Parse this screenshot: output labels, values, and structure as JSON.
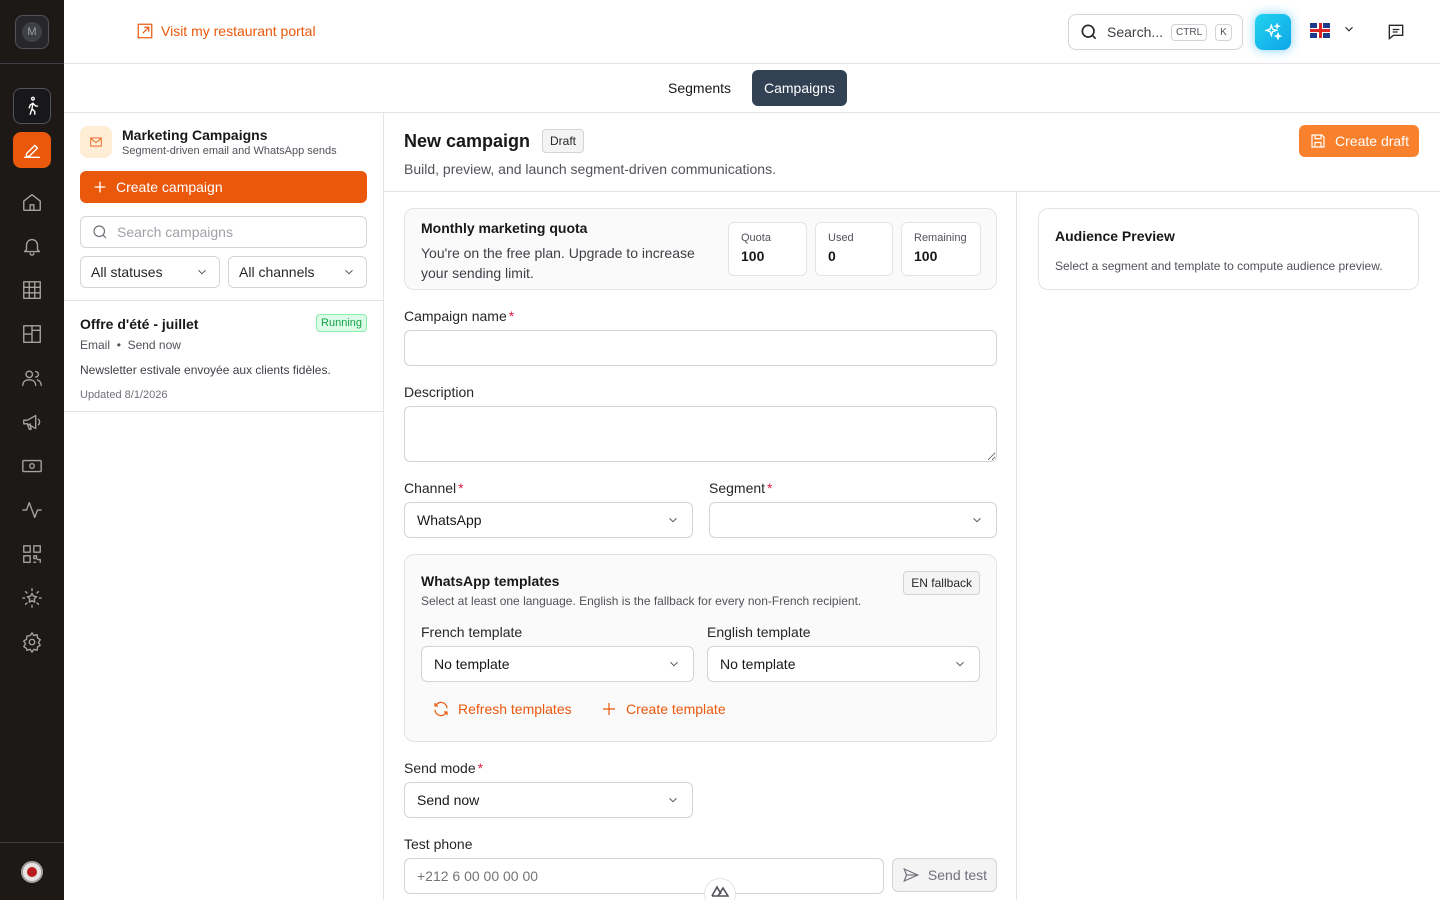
{
  "rail": {
    "avatar_initial": "M",
    "nav": [
      {
        "icon": "person-walking-icon"
      },
      {
        "icon": "pencil-square-icon"
      },
      {
        "icon": "home-icon"
      },
      {
        "icon": "bell-icon"
      },
      {
        "icon": "grid-icon"
      },
      {
        "icon": "layout-icon"
      },
      {
        "icon": "users-icon"
      },
      {
        "icon": "megaphone-icon"
      },
      {
        "icon": "cash-icon"
      },
      {
        "icon": "activity-icon"
      },
      {
        "icon": "qr-code-icon"
      },
      {
        "icon": "star-badge-icon"
      },
      {
        "icon": "settings-gear-icon"
      }
    ]
  },
  "topbar": {
    "portal_link": "Visit my restaurant portal",
    "search_label": "Search...",
    "kbd_ctrl": "CTRL",
    "kbd_k": "K"
  },
  "tabs": [
    {
      "label": "Segments",
      "active": false
    },
    {
      "label": "Campaigns",
      "active": true
    }
  ],
  "left_panel": {
    "title": "Marketing Campaigns",
    "subtitle": "Segment-driven email and WhatsApp sends",
    "create_button": "Create campaign",
    "search_placeholder": "Search campaigns",
    "status_filter": "All statuses",
    "channel_filter": "All channels",
    "campaigns": [
      {
        "name": "Offre d'été - juillet",
        "status": "Running",
        "channel": "Email",
        "separator": "•",
        "mode": "Send now",
        "description": "Newsletter estivale envoyée aux clients fidèles.",
        "updated": "Updated 8/1/2026"
      }
    ]
  },
  "header": {
    "title": "New campaign",
    "badge": "Draft",
    "subtitle": "Build, preview, and launch segment-driven communications.",
    "create_draft": "Create draft"
  },
  "quota": {
    "title": "Monthly marketing quota",
    "text": "You're on the free plan. Upgrade to increase your sending limit.",
    "cards": [
      {
        "label": "Quota",
        "value": "100"
      },
      {
        "label": "Used",
        "value": "0"
      },
      {
        "label": "Remaining",
        "value": "100"
      }
    ]
  },
  "form": {
    "campaign_name_label": "Campaign name",
    "description_label": "Description",
    "channel_label": "Channel",
    "channel_value": "WhatsApp",
    "segment_label": "Segment",
    "segment_value": "",
    "required_mark": "*",
    "send_mode_label": "Send mode",
    "send_mode_value": "Send now",
    "test_phone_label": "Test phone",
    "test_phone_placeholder": "+212 6 00 00 00 00",
    "send_test": "Send test"
  },
  "whatsapp": {
    "title": "WhatsApp templates",
    "subtitle": "Select at least one language. English is the fallback for every non-French recipient.",
    "badge": "EN fallback",
    "french_label": "French template",
    "french_value": "No template",
    "english_label": "English template",
    "english_value": "No template",
    "refresh": "Refresh templates",
    "create": "Create template"
  },
  "audience": {
    "title": "Audience Preview",
    "subtitle": "Select a segment and template to compute audience preview."
  },
  "colors": {
    "accent": "#ea580c",
    "rail_bg": "#1c1917",
    "tab_active": "#334155",
    "running_green": "#16a34a"
  }
}
